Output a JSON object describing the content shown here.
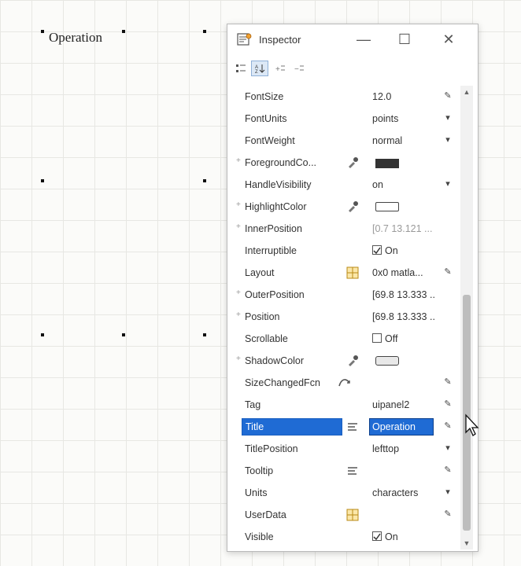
{
  "canvas": {
    "panel_title": "Operation"
  },
  "inspector": {
    "window_title": "Inspector",
    "minimize": "—",
    "maximize": "☐",
    "close": "✕",
    "properties": [
      {
        "name": "FontSize",
        "value": "12.0",
        "control": "edit"
      },
      {
        "name": "FontUnits",
        "value": "points",
        "control": "dropdown"
      },
      {
        "name": "FontWeight",
        "value": "normal",
        "control": "dropdown"
      },
      {
        "name": "ForegroundCo...",
        "value": "",
        "icon": "color-picker-icon",
        "swatch": "#333333",
        "expand": true
      },
      {
        "name": "HandleVisibility",
        "value": "on",
        "control": "dropdown"
      },
      {
        "name": "HighlightColor",
        "value": "",
        "icon": "color-picker-icon",
        "swatch": "#ffffff",
        "expand": true
      },
      {
        "name": "InnerPosition",
        "value": "[0.7 13.121 ...",
        "faded": true,
        "expand": true
      },
      {
        "name": "Interruptible",
        "value": "On",
        "checkbox": true
      },
      {
        "name": "Layout",
        "value": "0x0 matla...",
        "icon": "grid-icon",
        "control": "edit"
      },
      {
        "name": "OuterPosition",
        "value": "[69.8 13.333 ...",
        "expand": true
      },
      {
        "name": "Position",
        "value": "[69.8 13.333 ...",
        "expand": true
      },
      {
        "name": "Scrollable",
        "value": "Off",
        "checkbox": true
      },
      {
        "name": "ShadowColor",
        "value": "",
        "icon": "color-picker-icon",
        "swatch": "#e8e8e8",
        "expand": true
      },
      {
        "name": "SizeChangedFcn",
        "value": "",
        "icon": "callback-icon",
        "control": "edit"
      },
      {
        "name": "Tag",
        "value": "uipanel2",
        "control": "edit"
      },
      {
        "name": "Title",
        "value": "Operation",
        "icon": "text-icon",
        "control": "edit",
        "selected": true
      },
      {
        "name": "TitlePosition",
        "value": "lefttop",
        "control": "dropdown"
      },
      {
        "name": "Tooltip",
        "value": "",
        "icon": "text-icon",
        "control": "edit"
      },
      {
        "name": "Units",
        "value": "characters",
        "control": "dropdown"
      },
      {
        "name": "UserData",
        "value": "",
        "icon": "grid-icon",
        "control": "edit"
      },
      {
        "name": "Visible",
        "value": "On",
        "checkbox": true,
        "control": "dropdown"
      }
    ]
  },
  "colors": {
    "selection": "#1f6bd4",
    "grid": "#e7e7e3"
  }
}
